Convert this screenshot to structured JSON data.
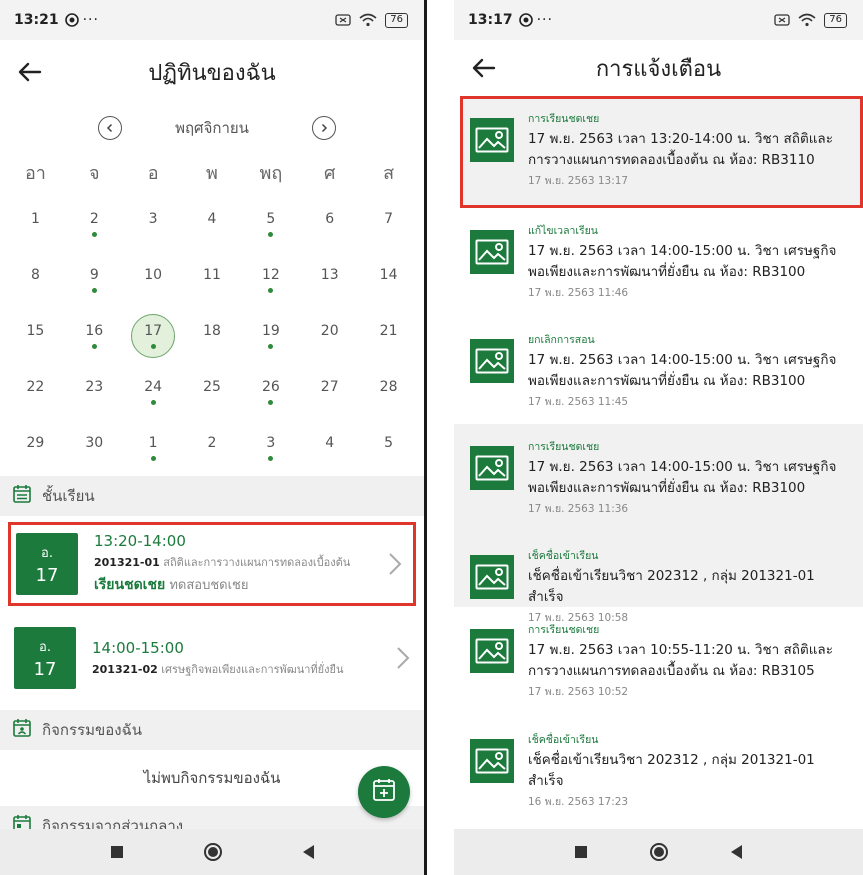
{
  "left": {
    "status": {
      "time": "13:21",
      "battery": "76"
    },
    "title": "ปฏิทินของฉัน",
    "month": "พฤศจิกายน",
    "weekdays": [
      "อา",
      "จ",
      "อ",
      "พ",
      "พฤ",
      "ศ",
      "ส"
    ],
    "days": [
      {
        "n": "1",
        "dot": false
      },
      {
        "n": "2",
        "dot": true
      },
      {
        "n": "3",
        "dot": false
      },
      {
        "n": "4",
        "dot": false
      },
      {
        "n": "5",
        "dot": true
      },
      {
        "n": "6",
        "dot": false
      },
      {
        "n": "7",
        "dot": false
      },
      {
        "n": "8",
        "dot": false
      },
      {
        "n": "9",
        "dot": true
      },
      {
        "n": "10",
        "dot": false
      },
      {
        "n": "11",
        "dot": false
      },
      {
        "n": "12",
        "dot": true
      },
      {
        "n": "13",
        "dot": false
      },
      {
        "n": "14",
        "dot": false
      },
      {
        "n": "15",
        "dot": false
      },
      {
        "n": "16",
        "dot": true
      },
      {
        "n": "17",
        "dot": true,
        "selected": true
      },
      {
        "n": "18",
        "dot": false
      },
      {
        "n": "19",
        "dot": true
      },
      {
        "n": "20",
        "dot": false
      },
      {
        "n": "21",
        "dot": false
      },
      {
        "n": "22",
        "dot": false
      },
      {
        "n": "23",
        "dot": false
      },
      {
        "n": "24",
        "dot": true
      },
      {
        "n": "25",
        "dot": false
      },
      {
        "n": "26",
        "dot": true
      },
      {
        "n": "27",
        "dot": false
      },
      {
        "n": "28",
        "dot": false
      },
      {
        "n": "29",
        "dot": false
      },
      {
        "n": "30",
        "dot": false
      },
      {
        "n": "1",
        "dot": true
      },
      {
        "n": "2",
        "dot": false
      },
      {
        "n": "3",
        "dot": true
      },
      {
        "n": "4",
        "dot": false
      },
      {
        "n": "5",
        "dot": false
      }
    ],
    "classes_header": "ชั้นเรียน",
    "classes": [
      {
        "weekday": "อ.",
        "day": "17",
        "time": "13:20-14:00",
        "code": "201321-01",
        "subject": "สถิติและการวางแผนการทดลองเบื้องต้น",
        "type": "เรียนชดเชย",
        "note": "ทดสอบชดเชย",
        "highlight": true
      },
      {
        "weekday": "อ.",
        "day": "17",
        "time": "14:00-15:00",
        "code": "201321-02",
        "subject": "เศรษฐกิจพอเพียงและการพัฒนาที่ยั่งยืน",
        "type": "",
        "note": "",
        "highlight": false
      }
    ],
    "my_activities_header": "กิจกรรมของฉัน",
    "my_activities_empty": "ไม่พบกิจกรรมของฉัน",
    "central_activities_header": "กิจกรรมจากส่วนกลาง"
  },
  "right": {
    "status": {
      "time": "13:17",
      "battery": "76"
    },
    "title": "การแจ้งเตือน",
    "notifications": [
      {
        "category": "การเรียนชดเชย",
        "text": "17 พ.ย. 2563 เวลา 13:20-14:00 น. วิชา สถิติและการวางแผนการทดลองเบื้องต้น ณ ห้อง: RB3110",
        "time": "17 พ.ย. 2563 13:17",
        "grey": true,
        "highlight": true
      },
      {
        "category": "แก้ไขเวลาเรียน",
        "text": "17 พ.ย. 2563 เวลา 14:00-15:00 น. วิชา เศรษฐกิจพอเพียงและการพัฒนาที่ยั่งยืน ณ ห้อง: RB3100",
        "time": "17 พ.ย. 2563 11:46",
        "grey": false,
        "highlight": false
      },
      {
        "category": "ยกเลิกการสอน",
        "text": "17 พ.ย. 2563 เวลา 14:00-15:00 น. วิชา เศรษฐกิจพอเพียงและการพัฒนาที่ยั่งยืน ณ ห้อง: RB3100",
        "time": "17 พ.ย. 2563 11:45",
        "grey": false,
        "highlight": false
      },
      {
        "category": "การเรียนชดเชย",
        "text": "17 พ.ย. 2563 เวลา 14:00-15:00 น. วิชา เศรษฐกิจพอเพียงและการพัฒนาที่ยั่งยืน ณ ห้อง: RB3100",
        "time": "17 พ.ย. 2563 11:36",
        "grey": true,
        "highlight": false
      },
      {
        "category": "เช็คชื่อเข้าเรียน",
        "text": "เช็คชื่อเข้าเรียนวิชา 202312 , กลุ่ม 201321-01 สำเร็จ",
        "time": "17 พ.ย. 2563 10:58",
        "grey": true,
        "highlight": false
      },
      {
        "category": "การเรียนชดเชย",
        "text": "17 พ.ย. 2563 เวลา 10:55-11:20 น. วิชา สถิติและการวางแผนการทดลองเบื้องต้น ณ ห้อง: RB3105",
        "time": "17 พ.ย. 2563 10:52",
        "grey": false,
        "highlight": false
      },
      {
        "category": "เช็คชื่อเข้าเรียน",
        "text": "เช็คชื่อเข้าเรียนวิชา 202312 , กลุ่ม 201321-01 สำเร็จ",
        "time": "16 พ.ย. 2563 17:23",
        "grey": false,
        "highlight": false
      }
    ]
  },
  "colors": {
    "accent": "#1b7a3c",
    "highlight_border": "#e0352b",
    "dot": "#2e8b3a"
  }
}
